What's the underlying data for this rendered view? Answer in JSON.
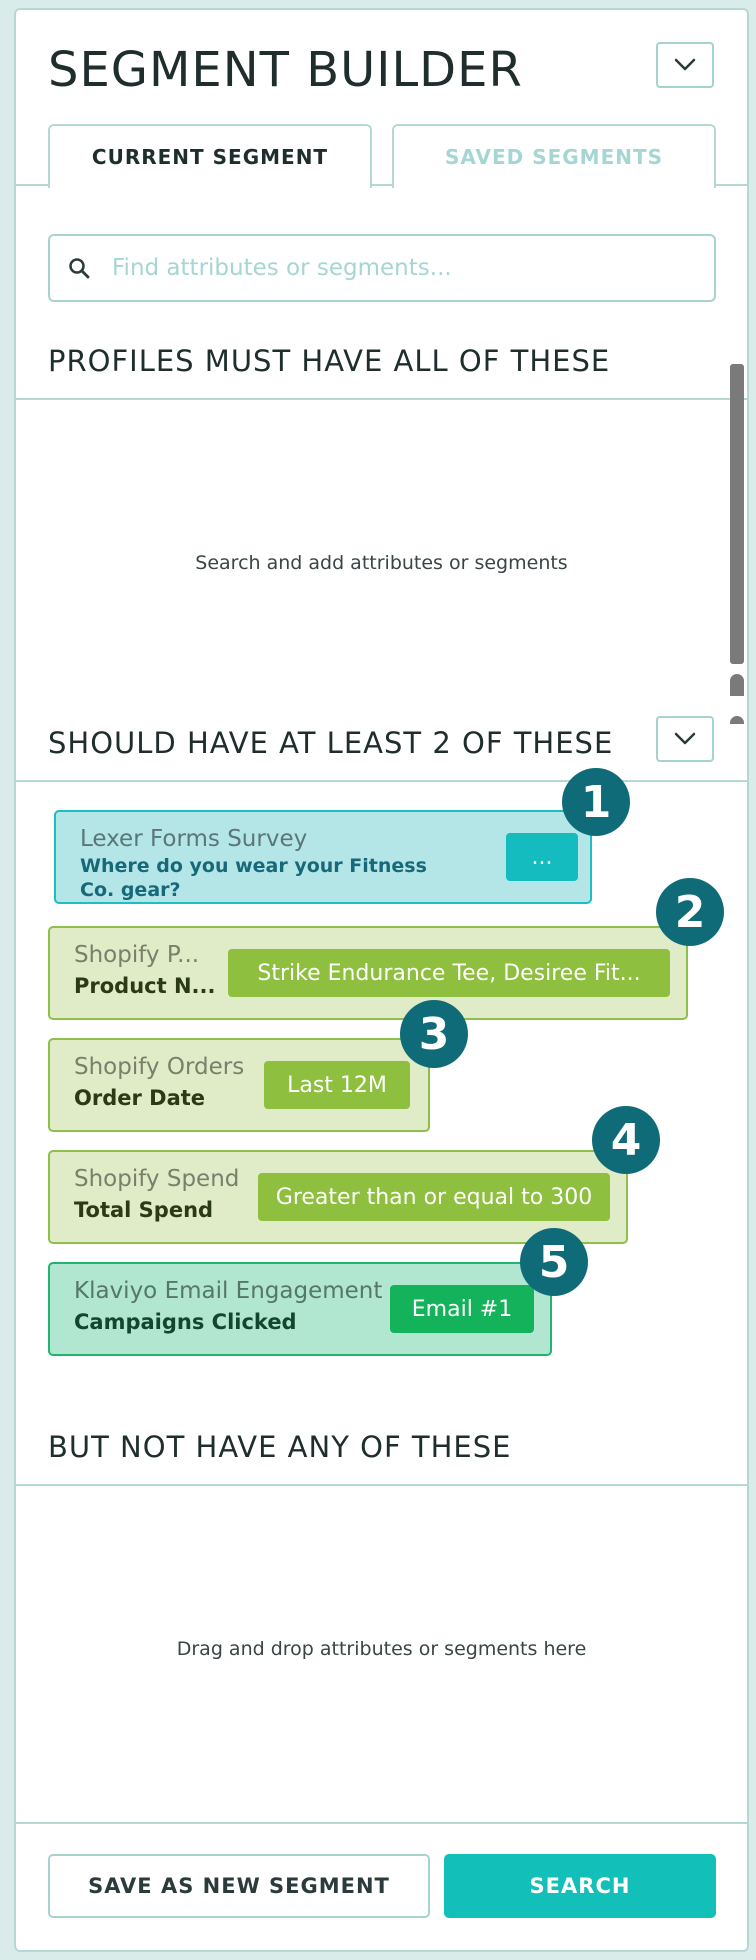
{
  "header": {
    "title": "SEGMENT BUILDER"
  },
  "tabs": [
    {
      "label": "CURRENT SEGMENT",
      "active": true
    },
    {
      "label": "SAVED SEGMENTS",
      "active": false
    }
  ],
  "search": {
    "placeholder": "Find attributes or segments...",
    "value": ""
  },
  "sections": {
    "must": {
      "title": "PROFILES MUST HAVE ALL OF THESE",
      "hint": "Search and add attributes or segments"
    },
    "should": {
      "title": "SHOULD HAVE AT LEAST 2 OF THESE"
    },
    "not": {
      "title": "BUT NOT HAVE ANY OF THESE",
      "hint": "Drag and drop attributes or segments here"
    }
  },
  "conditions": [
    {
      "badge": "1",
      "label": "Lexer Forms Survey",
      "sub": "Where do you wear your Fitness Co. gear?",
      "value": "..."
    },
    {
      "badge": "2",
      "label": "Shopify P...",
      "sub": "Product N...",
      "value": "Strike Endurance Tee, Desiree Fit..."
    },
    {
      "badge": "3",
      "label": "Shopify Orders",
      "sub": "Order Date",
      "value": "Last 12M"
    },
    {
      "badge": "4",
      "label": "Shopify Spend",
      "sub": "Total Spend",
      "value": "Greater than or equal to 300"
    },
    {
      "badge": "5",
      "label": "Klaviyo Email Engagement",
      "sub": "Campaigns Clicked",
      "value": "Email #1"
    }
  ],
  "footer": {
    "save_label": "SAVE AS NEW SEGMENT",
    "search_label": "SEARCH"
  },
  "colors": {
    "accent": "#13bfb9",
    "badge": "#0f6b77",
    "shopify": "#8ebf3f",
    "klaviyo": "#14b25a",
    "lexer": "#1cbdc3"
  }
}
